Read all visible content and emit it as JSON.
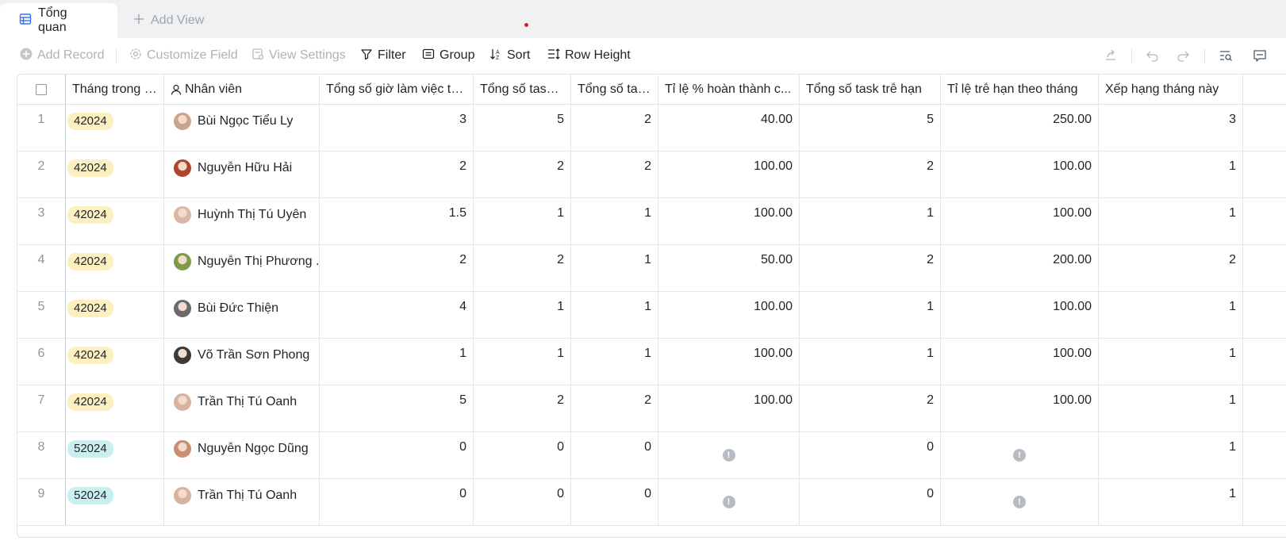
{
  "tabs": {
    "active_label": "Tổng quan",
    "add_view_label": "Add View"
  },
  "toolbar": {
    "add_record": "Add Record",
    "customize_field": "Customize Field",
    "view_settings": "View Settings",
    "filter": "Filter",
    "group": "Group",
    "sort": "Sort",
    "row_height": "Row Height"
  },
  "columns": [
    "Tháng trong năm",
    "Nhân viên",
    "Tổng số giờ làm việc tro...",
    "Tổng số task ...",
    "Tổng số tas...",
    "Tỉ lệ % hoàn thành c...",
    "Tổng số task trễ hạn",
    "Tỉ lệ trễ hạn theo tháng",
    "Xếp hạng tháng này"
  ],
  "colors": {
    "pill_42024_bg": "#fcefc0",
    "pill_52024_bg": "#c9f0ee",
    "accent": "#3370ff"
  },
  "rows": [
    {
      "num": "1",
      "month": "42024",
      "month_kind": "a",
      "name": "Bùi Ngọc Tiểu Ly",
      "hours": "3",
      "tasks_a": "5",
      "tasks_b": "2",
      "pct_done": "40.00",
      "late": "5",
      "late_rate": "250.00",
      "rank": "3",
      "av": "#caa58b"
    },
    {
      "num": "2",
      "month": "42024",
      "month_kind": "a",
      "name": "Nguyễn Hữu Hải",
      "hours": "2",
      "tasks_a": "2",
      "tasks_b": "2",
      "pct_done": "100.00",
      "late": "2",
      "late_rate": "100.00",
      "rank": "1",
      "av": "#b0452d"
    },
    {
      "num": "3",
      "month": "42024",
      "month_kind": "a",
      "name": "Huỳnh Thị Tú Uyên",
      "hours": "1.5",
      "tasks_a": "1",
      "tasks_b": "1",
      "pct_done": "100.00",
      "late": "1",
      "late_rate": "100.00",
      "rank": "1",
      "av": "#d9b8a8"
    },
    {
      "num": "4",
      "month": "42024",
      "month_kind": "a",
      "name": "Nguyễn Thị Phương ...",
      "hours": "2",
      "tasks_a": "2",
      "tasks_b": "1",
      "pct_done": "50.00",
      "late": "2",
      "late_rate": "200.00",
      "rank": "2",
      "av": "#7f9a4b"
    },
    {
      "num": "5",
      "month": "42024",
      "month_kind": "a",
      "name": "Bùi Đức Thiện",
      "hours": "4",
      "tasks_a": "1",
      "tasks_b": "1",
      "pct_done": "100.00",
      "late": "1",
      "late_rate": "100.00",
      "rank": "1",
      "av": "#6b6b6b"
    },
    {
      "num": "6",
      "month": "42024",
      "month_kind": "a",
      "name": "Võ Trần Sơn Phong",
      "hours": "1",
      "tasks_a": "1",
      "tasks_b": "1",
      "pct_done": "100.00",
      "late": "1",
      "late_rate": "100.00",
      "rank": "1",
      "av": "#3a3a3a"
    },
    {
      "num": "7",
      "month": "42024",
      "month_kind": "a",
      "name": "Trần Thị Tú Oanh",
      "hours": "5",
      "tasks_a": "2",
      "tasks_b": "2",
      "pct_done": "100.00",
      "late": "2",
      "late_rate": "100.00",
      "rank": "1",
      "av": "#d8b39d"
    },
    {
      "num": "8",
      "month": "52024",
      "month_kind": "b",
      "name": "Nguyễn Ngọc Dũng",
      "hours": "0",
      "tasks_a": "0",
      "tasks_b": "0",
      "pct_done": "",
      "late": "0",
      "late_rate": "",
      "rank": "1",
      "av": "#c98f72"
    },
    {
      "num": "9",
      "month": "52024",
      "month_kind": "b",
      "name": "Trần Thị Tú Oanh",
      "hours": "0",
      "tasks_a": "0",
      "tasks_b": "0",
      "pct_done": "",
      "late": "0",
      "late_rate": "",
      "rank": "1",
      "av": "#d8b39d"
    }
  ],
  "warn_glyph": "!"
}
